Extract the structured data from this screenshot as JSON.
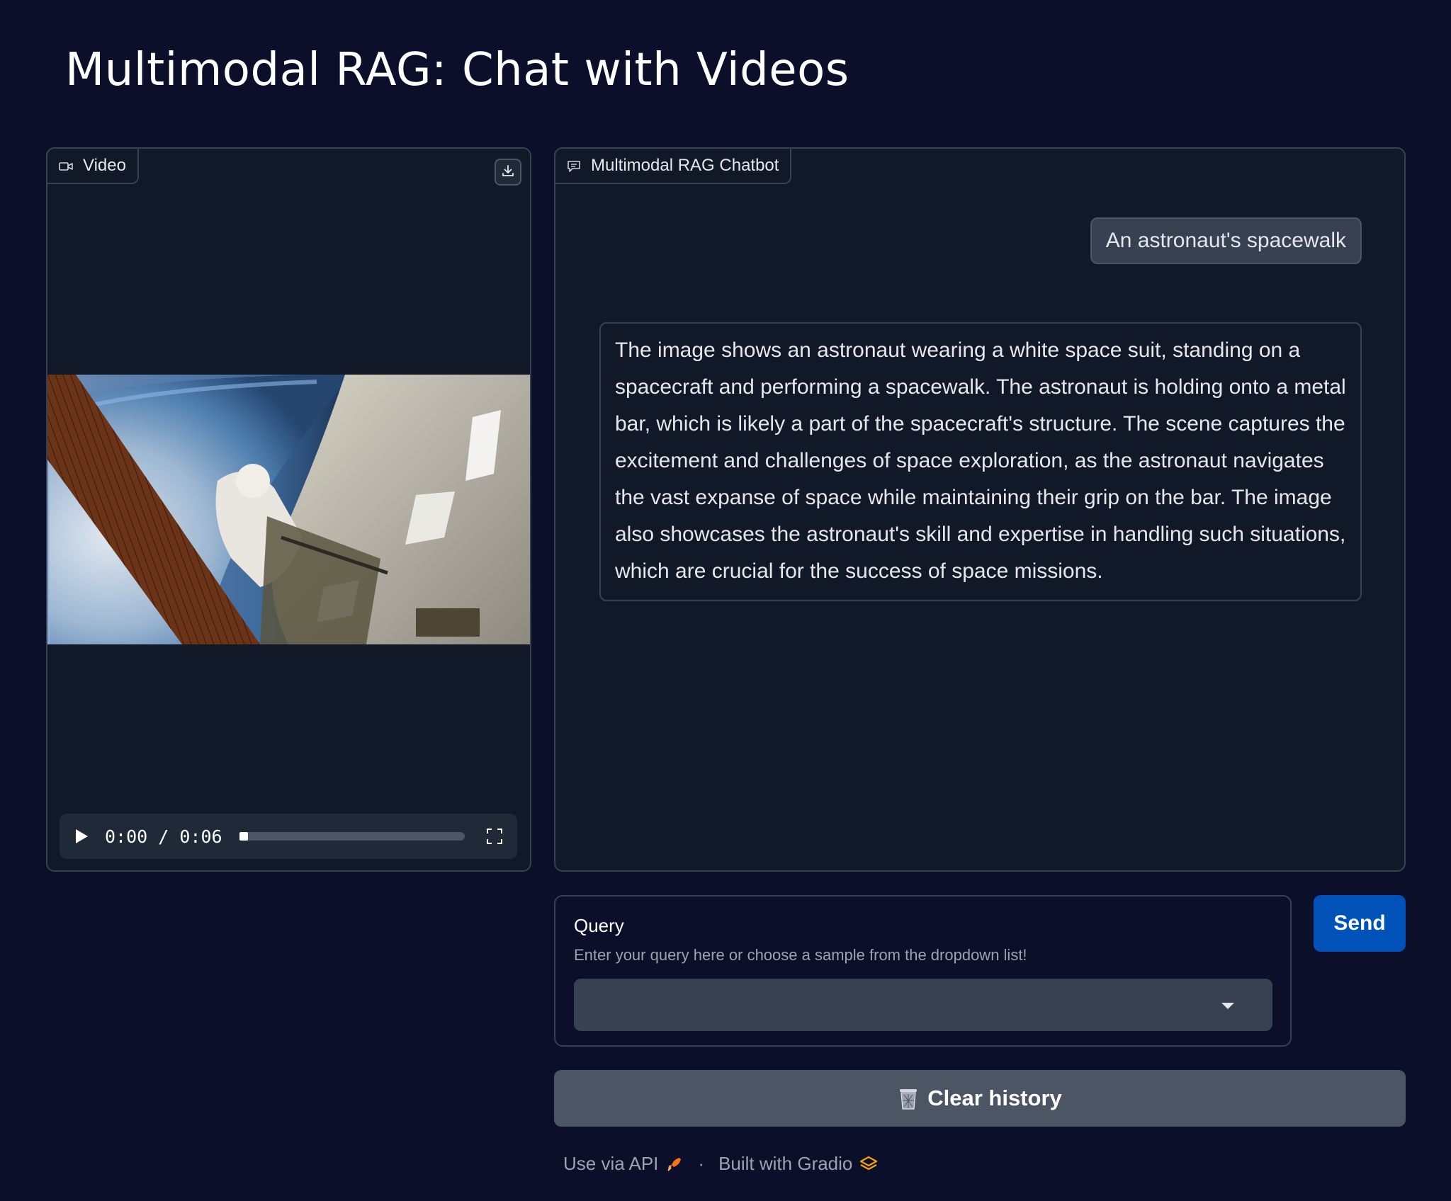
{
  "page": {
    "title": "Multimodal RAG: Chat with Videos"
  },
  "video_panel": {
    "label": "Video",
    "icons": {
      "tab": "video-camera-icon",
      "download": "download-icon",
      "play": "play-icon",
      "fullscreen": "fullscreen-icon"
    },
    "player": {
      "time": "0:00 / 0:06",
      "progress_fraction": 0.04
    }
  },
  "chat_panel": {
    "label": "Multimodal RAG Chatbot",
    "icon": "chat-icon",
    "messages": [
      {
        "role": "user",
        "text": "An astronaut's spacewalk"
      },
      {
        "role": "bot",
        "text": "The image shows an astronaut wearing a white space suit, standing on a spacecraft and performing a spacewalk. The astronaut is holding onto a metal bar, which is likely a part of the spacecraft's structure. The scene captures the excitement and challenges of space exploration, as the astronaut navigates the vast expanse of space while maintaining their grip on the bar. The image also showcases the astronaut's skill and expertise in handling such situations, which are crucial for the success of space missions."
      }
    ]
  },
  "query": {
    "label": "Query",
    "info": "Enter your query here or choose a sample from the dropdown list!",
    "selected_value": ""
  },
  "send_label": "Send",
  "clear_label": "Clear history",
  "clear_icon": "trash-icon",
  "footer": {
    "api_label": "Use via API",
    "separator": "·",
    "built_label": "Built with Gradio",
    "icons": {
      "api": "rocket-icon",
      "gradio": "gradio-logo-icon"
    }
  },
  "colors": {
    "background": "#0b0f29",
    "panel": "#111827",
    "border": "#374151",
    "primary": "#0051b8",
    "secondary_button": "#4b5563"
  }
}
